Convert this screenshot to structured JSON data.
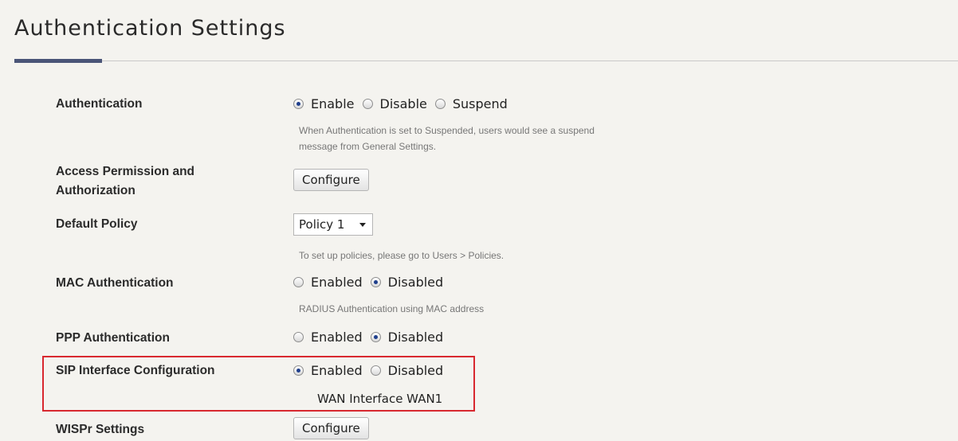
{
  "page": {
    "title": "Authentication Settings"
  },
  "rows": {
    "authentication": {
      "label": "Authentication",
      "options": [
        "Enable",
        "Disable",
        "Suspend"
      ],
      "selected": "Enable",
      "hint_line1": "When Authentication is set to Suspended, users would see a suspend",
      "hint_line2": "message from General Settings."
    },
    "access_permission": {
      "label_line1": "Access Permission and",
      "label_line2": "Authorization",
      "button_label": "Configure"
    },
    "default_policy": {
      "label": "Default Policy",
      "selected_value": "Policy 1",
      "hint": "To set up policies, please go to Users > Policies."
    },
    "mac_authentication": {
      "label": "MAC Authentication",
      "options": [
        "Enabled",
        "Disabled"
      ],
      "selected": "Disabled",
      "hint": "RADIUS Authentication using MAC address"
    },
    "ppp_authentication": {
      "label": "PPP Authentication",
      "options": [
        "Enabled",
        "Disabled"
      ],
      "selected": "Disabled"
    },
    "sip_interface": {
      "label": "SIP Interface Configuration",
      "options": [
        "Enabled",
        "Disabled"
      ],
      "selected": "Enabled",
      "wan_text": "WAN Interface WAN1"
    },
    "wispr_settings": {
      "label": "WISPr Settings",
      "button_label": "Configure"
    }
  },
  "colors": {
    "highlight_box": "#d8282f",
    "title_accent": "#4a5578",
    "background": "#f4f3ef"
  }
}
